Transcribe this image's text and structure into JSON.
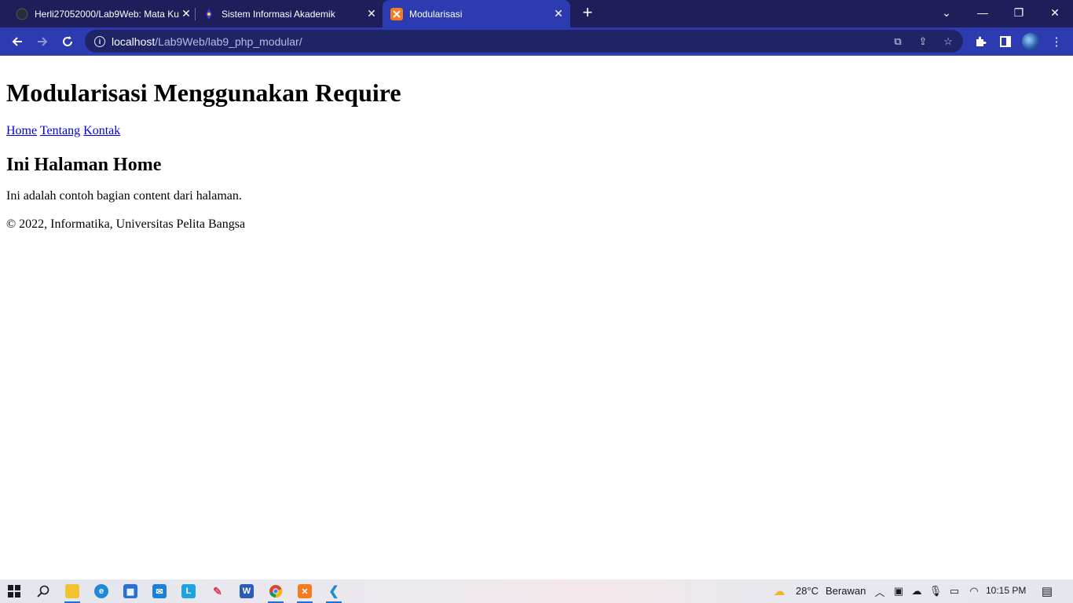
{
  "browser": {
    "tabs": [
      {
        "title": "Herli27052000/Lab9Web: Mata Ku",
        "icon": "github-icon",
        "active": false
      },
      {
        "title": "Sistem Informasi Akademik",
        "icon": "university-icon",
        "active": false
      },
      {
        "title": "Modularisasi",
        "icon": "xampp-icon",
        "active": true
      }
    ],
    "url_host": "localhost",
    "url_path": "/Lab9Web/lab9_php_modular/"
  },
  "page": {
    "title": "Modularisasi Menggunakan Require",
    "nav": [
      "Home",
      "Tentang",
      "Kontak"
    ],
    "heading": "Ini Halaman Home",
    "content": "Ini adalah contoh bagian content dari halaman.",
    "footer": "© 2022, Informatika, Universitas Pelita Bangsa"
  },
  "taskbar": {
    "weather_temp": "28°C",
    "weather_desc": "Berawan",
    "time": "10:15 PM"
  },
  "colors": {
    "tabbar": "#1f1d5a",
    "toolbar": "#2d3bb0",
    "link": "#0000ee"
  }
}
